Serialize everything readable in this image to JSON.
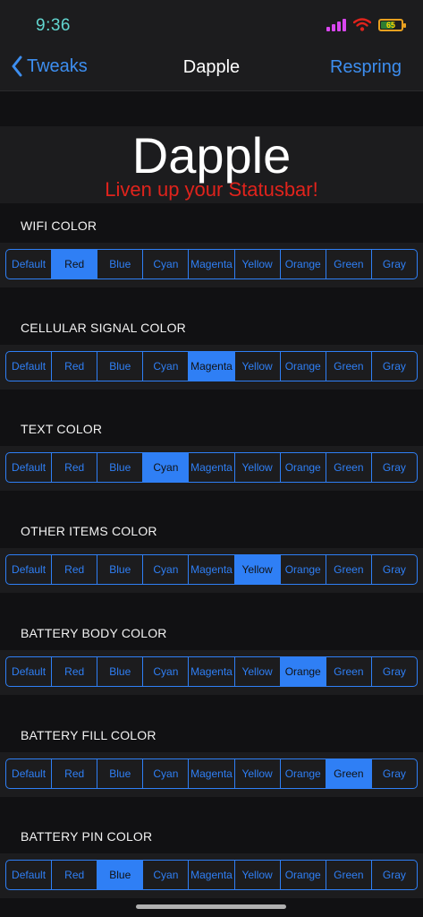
{
  "status": {
    "time": "9:36",
    "battery_level": "65",
    "battery_fraction": 0.65
  },
  "nav": {
    "back_label": "Tweaks",
    "title": "Dapple",
    "action_label": "Respring"
  },
  "header": {
    "title": "Dapple",
    "subtitle": "Liven up your Statusbar!"
  },
  "options": [
    "Default",
    "Red",
    "Blue",
    "Cyan",
    "Magenta",
    "Yellow",
    "Orange",
    "Green",
    "Gray"
  ],
  "sections": [
    {
      "key": "wifi",
      "label": "WIFI COLOR",
      "selected": "Red"
    },
    {
      "key": "cellular",
      "label": "CELLULAR SIGNAL COLOR",
      "selected": "Magenta"
    },
    {
      "key": "text",
      "label": "TEXT COLOR",
      "selected": "Cyan"
    },
    {
      "key": "other",
      "label": "OTHER ITEMS COLOR",
      "selected": "Yellow"
    },
    {
      "key": "battery-body",
      "label": "BATTERY BODY COLOR",
      "selected": "Orange"
    },
    {
      "key": "battery-fill",
      "label": "BATTERY FILL COLOR",
      "selected": "Green"
    },
    {
      "key": "battery-pin",
      "label": "BATTERY PIN COLOR",
      "selected": "Blue"
    }
  ],
  "colors": {
    "accent": "#2f7ff5",
    "nav_tint": "#3d8ef0",
    "subtitle": "#e0231c",
    "time": "#62d6d0"
  }
}
